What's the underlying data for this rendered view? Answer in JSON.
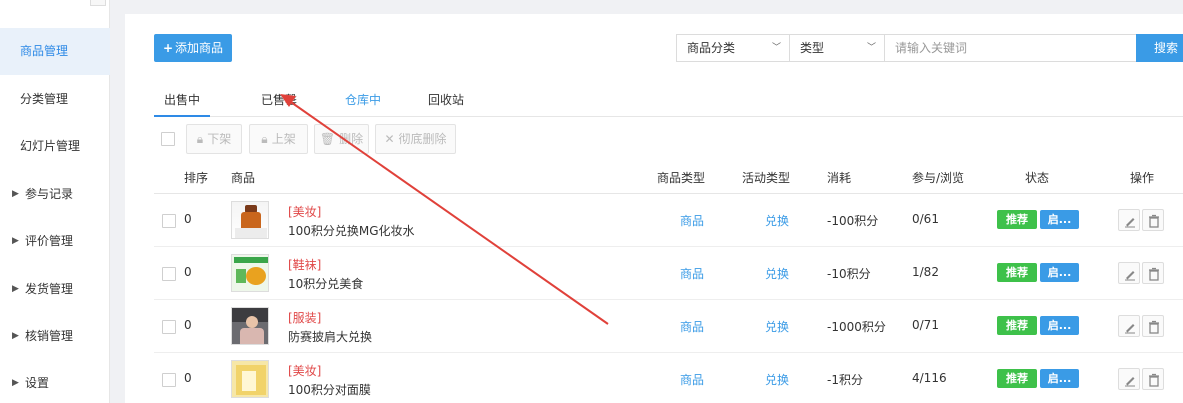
{
  "sidebar": {
    "items": [
      {
        "label": "商品管理",
        "active": true,
        "arrow": false
      },
      {
        "label": "分类管理",
        "active": false,
        "arrow": false
      },
      {
        "label": "幻灯片管理",
        "active": false,
        "arrow": false
      },
      {
        "label": "参与记录",
        "active": false,
        "arrow": true
      },
      {
        "label": "评价管理",
        "active": false,
        "arrow": true
      },
      {
        "label": "发货管理",
        "active": false,
        "arrow": true
      },
      {
        "label": "核销管理",
        "active": false,
        "arrow": true
      },
      {
        "label": "设置",
        "active": false,
        "arrow": true
      }
    ]
  },
  "toolbar_top": {
    "add_label": "添加商品",
    "category_select": "商品分类",
    "type_select": "类型",
    "search_placeholder": "请输入关键词",
    "search_label": "搜索"
  },
  "tabs": [
    "出售中",
    "已售罄",
    "仓库中",
    "回收站"
  ],
  "bulk": {
    "off_shelf": "下架",
    "on_shelf": "上架",
    "delete": "删除",
    "purge": "彻底删除"
  },
  "table": {
    "headers": [
      "排序",
      "商品",
      "商品类型",
      "活动类型",
      "消耗",
      "参与/浏览",
      "状态",
      "操作"
    ],
    "rows": [
      {
        "sort": "0",
        "category": "[美妆]",
        "name": "100积分兑换MG化妆水",
        "goods_type": "商品",
        "activity_type": "兑换",
        "cost": "-100积分",
        "stats": "0/61",
        "recommend": "推荐",
        "status": "启..."
      },
      {
        "sort": "0",
        "category": "[鞋袜]",
        "name": "10积分兑美食",
        "goods_type": "商品",
        "activity_type": "兑换",
        "cost": "-10积分",
        "stats": "1/82",
        "recommend": "推荐",
        "status": "启..."
      },
      {
        "sort": "0",
        "category": "[服装]",
        "name": "防赛披肩大兑换",
        "goods_type": "商品",
        "activity_type": "兑换",
        "cost": "-1000积分",
        "stats": "0/71",
        "recommend": "推荐",
        "status": "启..."
      },
      {
        "sort": "0",
        "category": "[美妆]",
        "name": "100积分对面膜",
        "goods_type": "商品",
        "activity_type": "兑换",
        "cost": "-1积分",
        "stats": "4/116",
        "recommend": "推荐",
        "status": "启..."
      }
    ]
  },
  "colors": {
    "accent": "#3a9be6",
    "danger_text": "#e04848",
    "recommend_badge": "#3ec14a",
    "annotation_arrow": "#e0413a"
  }
}
